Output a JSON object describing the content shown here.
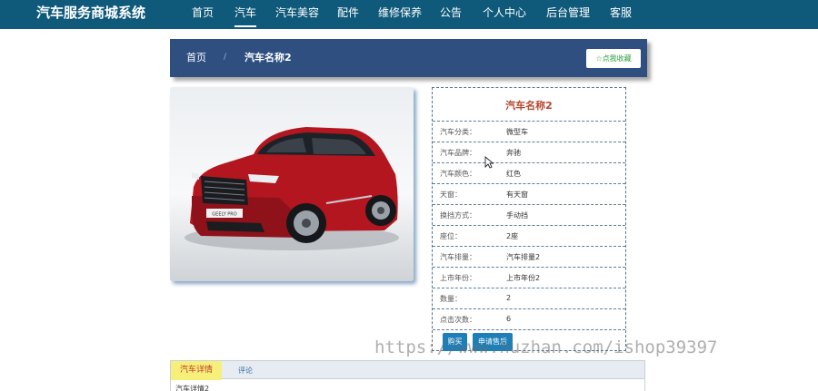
{
  "header": {
    "brand": "汽车服务商城系统",
    "nav": [
      "首页",
      "汽车",
      "汽车美容",
      "配件",
      "维修保养",
      "公告",
      "个人中心",
      "后台管理",
      "客服"
    ]
  },
  "breadcrumb": {
    "home": "首页",
    "separator": "/",
    "current": "汽车名称2",
    "favorite_label": "☆点我收藏"
  },
  "product": {
    "title": "汽车名称2",
    "attributes": [
      {
        "label": "汽车分类：",
        "value": "微型车"
      },
      {
        "label": "汽车品牌：",
        "value": "奔驰"
      },
      {
        "label": "汽车颜色：",
        "value": "红色"
      },
      {
        "label": "天窗：",
        "value": "有天窗"
      },
      {
        "label": "换挡方式：",
        "value": "手动挡"
      },
      {
        "label": "座位：",
        "value": "2座"
      },
      {
        "label": "汽车排量：",
        "value": "汽车排量2"
      },
      {
        "label": "上市年份：",
        "value": "上市年份2"
      },
      {
        "label": "数量：",
        "value": "2"
      },
      {
        "label": "点击次数：",
        "value": "6"
      }
    ],
    "buy_label": "购买",
    "after_sale_label": "申请售后",
    "plate_text": "GEELY PRO"
  },
  "details": {
    "tab_details": "汽车详情",
    "tab_comments": "评论",
    "content": "汽车详情2"
  },
  "watermark": "https://www.huzhan.com/ishop39397",
  "colors": {
    "topbar": "#0f5a7a",
    "crumbbar": "#2e4f80",
    "accent_blue": "#1c7fb8",
    "title_red": "#b5452c"
  }
}
